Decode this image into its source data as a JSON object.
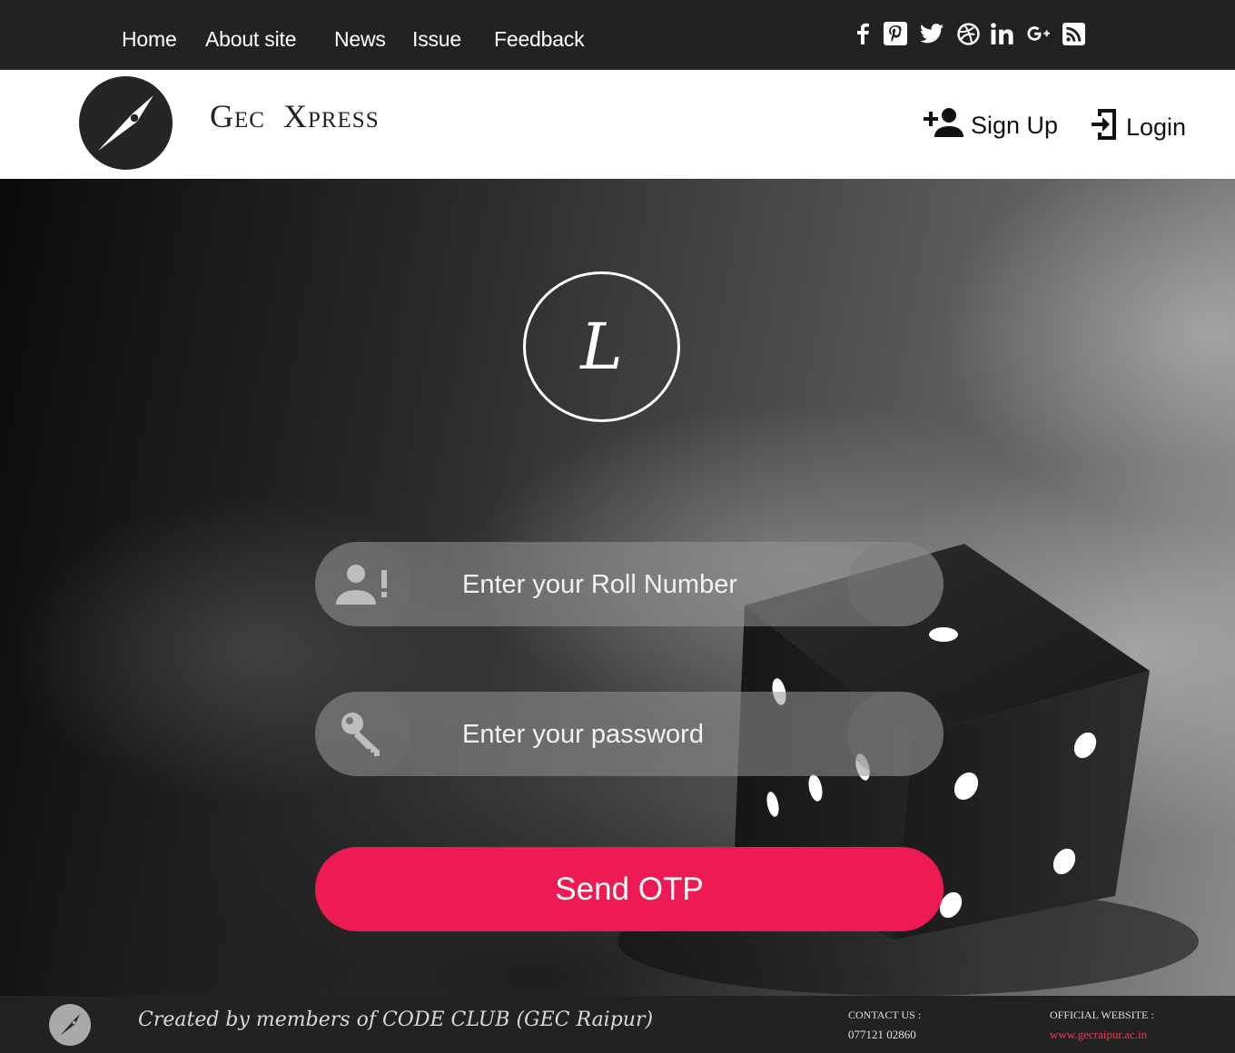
{
  "topnav": {
    "links": [
      "Home",
      "About site",
      "News",
      "Issue",
      "Feedback"
    ],
    "social_icons": [
      "facebook-icon",
      "pinterest-icon",
      "twitter-icon",
      "dribbble-icon",
      "linkedin-icon",
      "google-plus-icon",
      "rss-icon"
    ]
  },
  "header": {
    "brand": "Gec  Xpress",
    "signup_label": "Sign Up",
    "login_label": "Login"
  },
  "form": {
    "emblem_letter": "L",
    "roll_placeholder": "Enter your Roll Number",
    "password_placeholder": "Enter your password",
    "submit_label": "Send OTP"
  },
  "footer": {
    "credits": "Created by members of CODE CLUB (GEC Raipur)",
    "contact_heading": "CONTACT US :",
    "contact_phone": "077121 02860",
    "website_heading": "OFFICIAL WEBSITE :",
    "website_url": "www.gecraipur.ac.in"
  },
  "colors": {
    "nav_bg": "#222222",
    "accent": "#ee1a53",
    "link_red": "#ef3c4a"
  }
}
